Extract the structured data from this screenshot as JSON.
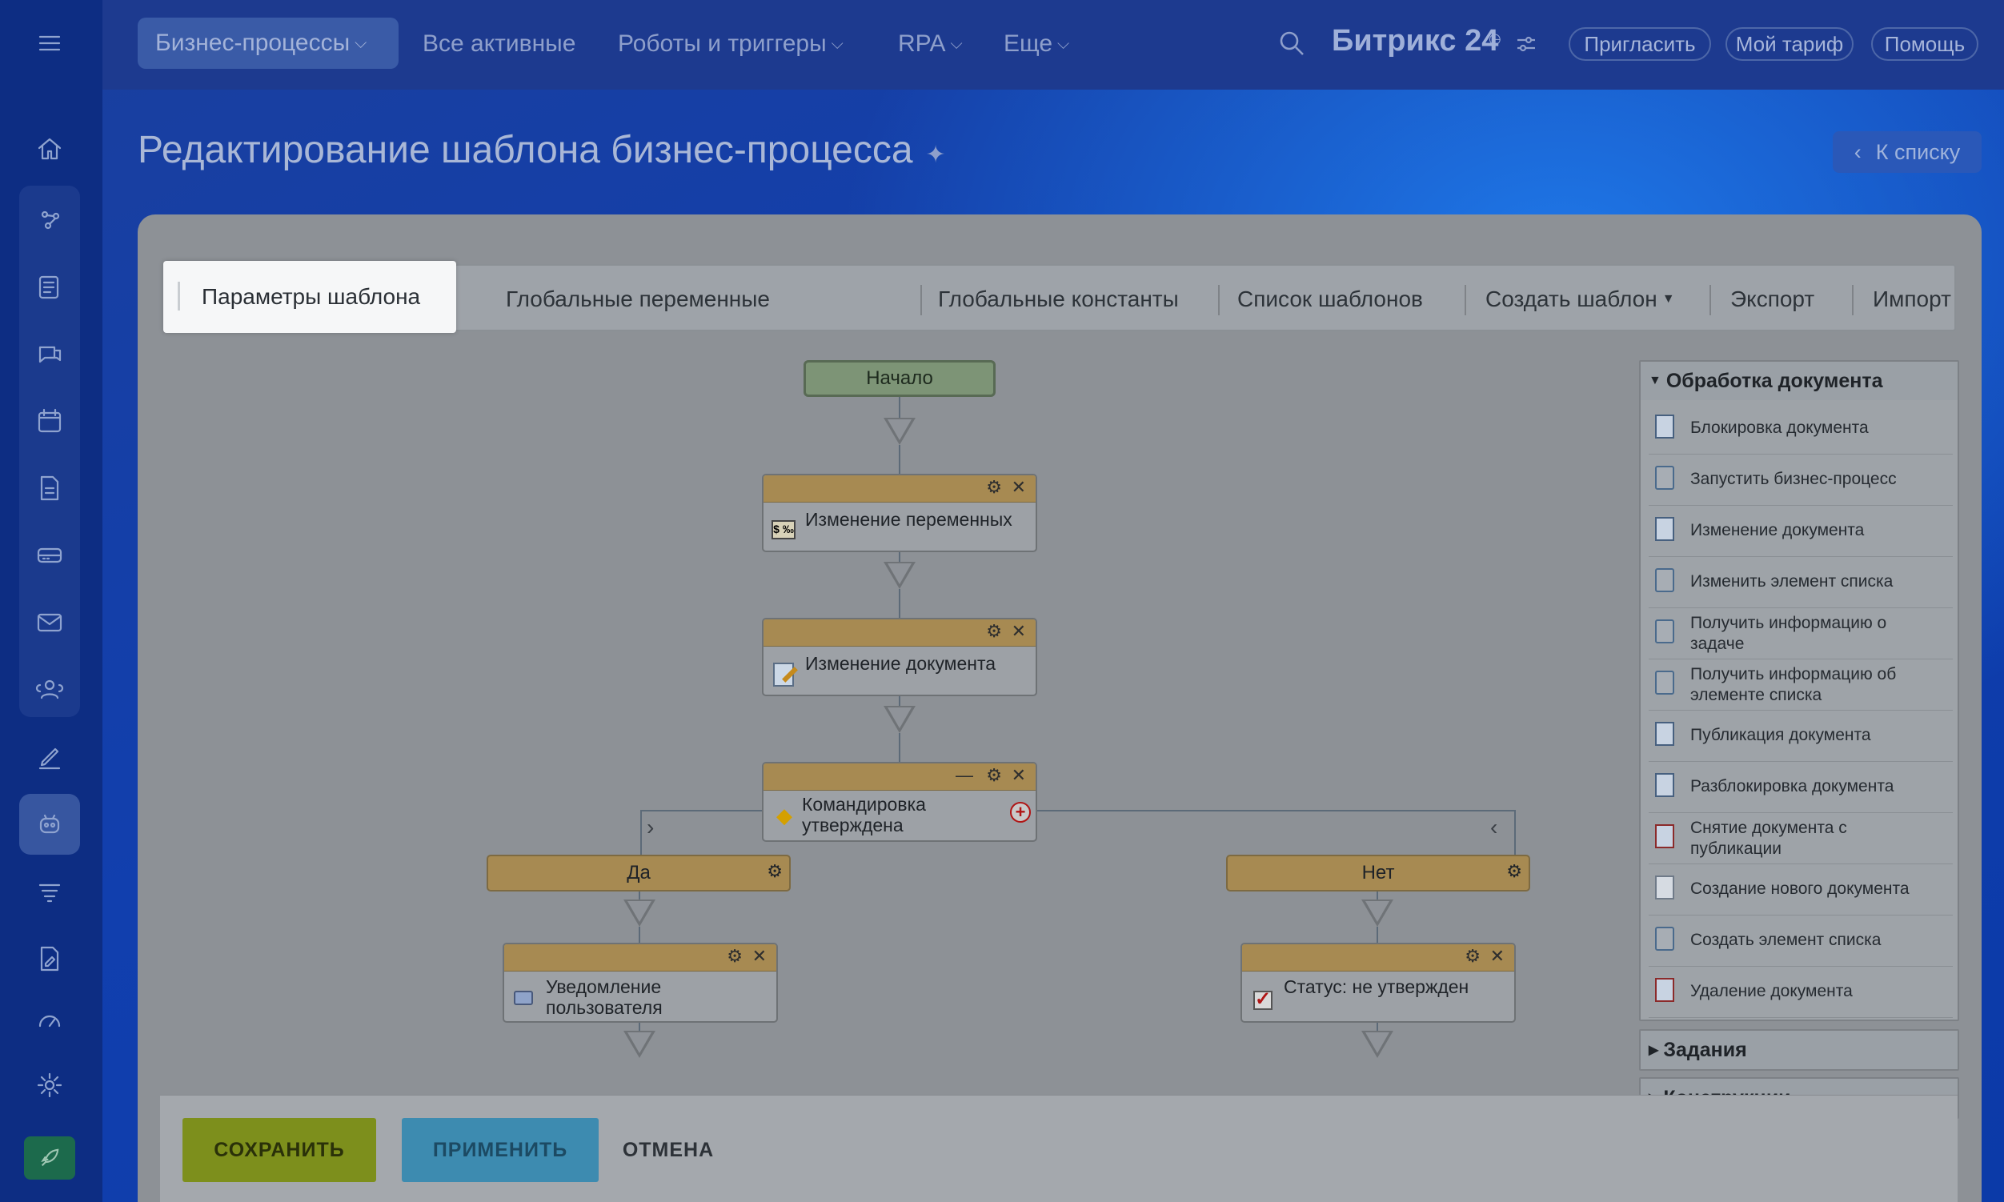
{
  "topbar": {
    "nav": [
      "Бизнес-процессы",
      "Все активные",
      "Роботы и триггеры",
      "RPA",
      "Еще"
    ],
    "brand": "Битрикс 24",
    "invite": "Пригласить",
    "tariff": "Мой тариф",
    "help": "Помощь"
  },
  "page": {
    "title": "Редактирование шаблона бизнес-процесса",
    "back": "К списку"
  },
  "tabs": [
    "Параметры шаблона",
    "Глобальные переменные",
    "Глобальные константы",
    "Список шаблонов",
    "Создать шаблон",
    "Экспорт",
    "Импорт"
  ],
  "diagram": {
    "start": "Начало",
    "change_vars": "Изменение переменных",
    "change_doc": "Изменение документа",
    "condition_line1": "Командировка",
    "condition_line2": "утверждена",
    "branch_yes": "Да",
    "branch_no": "Нет",
    "notify_line1": "Уведомление",
    "notify_line2": "пользователя",
    "status": "Статус: не утвержден"
  },
  "activities": {
    "section": "Обработка документа",
    "items": [
      {
        "line1": "Блокировка документа",
        "line2": "",
        "icon": "lock-doc"
      },
      {
        "line1": "Запустить бизнес-процесс",
        "line2": "",
        "icon": "generic"
      },
      {
        "line1": "Изменение документа",
        "line2": "",
        "icon": "edit-doc"
      },
      {
        "line1": "Изменить элемент списка",
        "line2": "",
        "icon": "generic"
      },
      {
        "line1": "Получить информацию о",
        "line2": "задаче",
        "icon": "generic"
      },
      {
        "line1": "Получить информацию об",
        "line2": "элементе списка",
        "icon": "generic"
      },
      {
        "line1": "Публикация документа",
        "line2": "",
        "icon": "publish-doc"
      },
      {
        "line1": "Разблокировка документа",
        "line2": "",
        "icon": "unlock-doc"
      },
      {
        "line1": "Снятие документа с",
        "line2": "публикации",
        "icon": "unpublish-doc"
      },
      {
        "line1": "Создание нового документа",
        "line2": "",
        "icon": "new-doc"
      },
      {
        "line1": "Создать элемент списка",
        "line2": "",
        "icon": "generic"
      },
      {
        "line1": "Удаление документа",
        "line2": "",
        "icon": "delete-doc"
      }
    ],
    "section2": "Задания",
    "section3": "Конструкции"
  },
  "footer": {
    "save": "СОХРАНИТЬ",
    "apply": "ПРИМЕНИТЬ",
    "cancel": "ОТМЕНА"
  },
  "colors": {
    "save_bg": "#7d8f1c",
    "apply_bg": "#3d8bb0"
  }
}
